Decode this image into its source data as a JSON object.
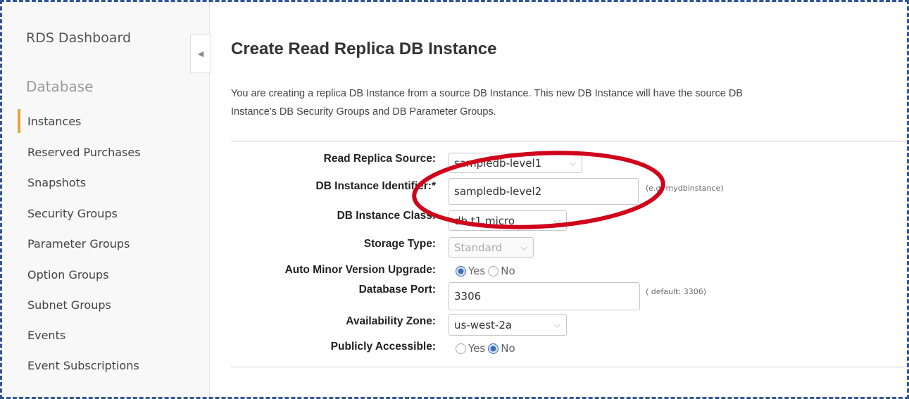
{
  "sidebar": {
    "title": "RDS Dashboard",
    "section": "Database",
    "items": [
      {
        "label": "Instances",
        "active": true
      },
      {
        "label": "Reserved Purchases"
      },
      {
        "label": "Snapshots"
      },
      {
        "label": "Security Groups"
      },
      {
        "label": "Parameter Groups"
      },
      {
        "label": "Option Groups"
      },
      {
        "label": "Subnet Groups"
      },
      {
        "label": "Events"
      },
      {
        "label": "Event Subscriptions"
      }
    ],
    "collapse_icon": "chevron-left-icon"
  },
  "main": {
    "title": "Create Read Replica DB Instance",
    "description_line1": "You are creating a replica DB Instance from a source DB Instance. This new DB Instance will have the source DB",
    "description_line2": "Instance's DB Security Groups and DB Parameter Groups."
  },
  "form": {
    "read_replica_source": {
      "label": "Read Replica Source:",
      "value": "sampledb-level1"
    },
    "db_instance_identifier": {
      "label": "DB Instance Identifier:*",
      "value": "sampledb-level2",
      "hint": "(e.g. mydbinstance)"
    },
    "db_instance_class": {
      "label": "DB Instance Class:",
      "value": "db.t1.micro"
    },
    "storage_type": {
      "label": "Storage Type:",
      "value": "Standard"
    },
    "auto_minor_version_upgrade": {
      "label": "Auto Minor Version Upgrade:",
      "options": [
        "Yes",
        "No"
      ],
      "selected": "Yes"
    },
    "database_port": {
      "label": "Database Port:",
      "value": "3306",
      "hint": "( default: 3306)"
    },
    "availability_zone": {
      "label": "Availability Zone:",
      "value": "us-west-2a"
    },
    "publicly_accessible": {
      "label": "Publicly Accessible:",
      "options": [
        "Yes",
        "No"
      ],
      "selected": "No"
    }
  },
  "colors": {
    "highlight_ellipse": "#d0021b",
    "frame_border": "#2f5597",
    "active_marker": "#e8a33d",
    "radio_selected": "#3c6fb7"
  }
}
